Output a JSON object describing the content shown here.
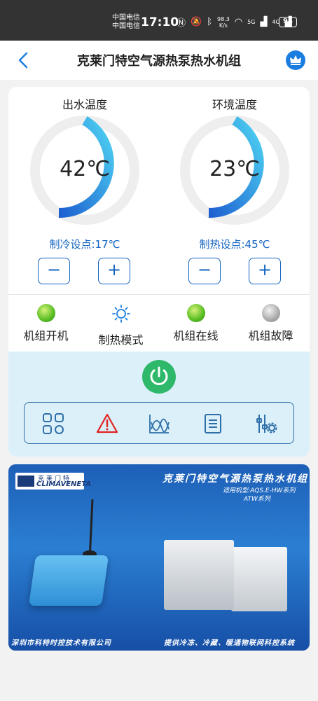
{
  "status_bar": {
    "carrier1": "中国电信",
    "carrier2": "中国电信",
    "time": "17:10",
    "speed_value": "98.3",
    "speed_unit": "K/s",
    "network1": "5G",
    "network2": "4G",
    "battery": "94"
  },
  "header": {
    "title": "克莱门特空气源热泵热水机组"
  },
  "gauges": {
    "outlet": {
      "label": "出水温度",
      "value": "42℃",
      "fill_fraction": 0.42
    },
    "ambient": {
      "label": "环境温度",
      "value": "23℃",
      "fill_fraction": 0.42
    }
  },
  "setpoints": {
    "cool": "制冷设点:17℃",
    "heat": "制热设点:45℃"
  },
  "buttons": {
    "minus": "−",
    "plus": "+"
  },
  "status": [
    {
      "label": "机组开机",
      "state": "on"
    },
    {
      "label": "制热模式",
      "state": "mode"
    },
    {
      "label": "机组在线",
      "state": "on"
    },
    {
      "label": "机组故障",
      "state": "off"
    }
  ],
  "banner": {
    "brand_cn": "克莱门特",
    "brand_en": "CLIMAVENETA",
    "title": "克莱门特空气源热泵热水机组",
    "models_line1": "适用机型:AQS.E-HW系列",
    "models_line2": "ATW系列",
    "company": "深圳市科特时控技术有限公司",
    "slogan": "提供冷冻、冷藏、暖通物联网科控系统"
  },
  "colors": {
    "accent": "#1565c0",
    "gauge_start": "#1d5fd0",
    "gauge_end": "#4ed3f2",
    "power": "#2db86a",
    "warning": "#e02424"
  }
}
